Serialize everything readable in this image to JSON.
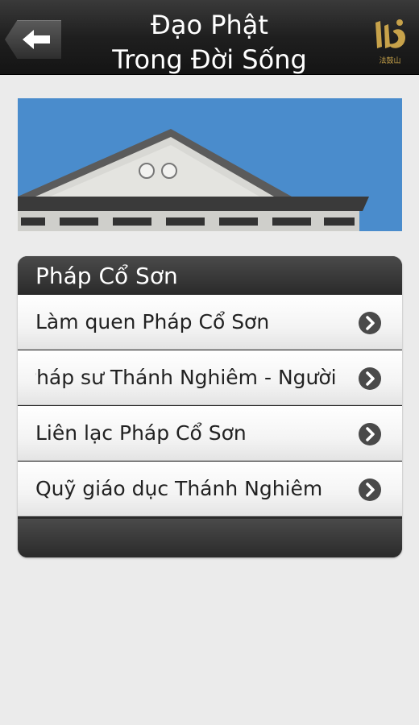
{
  "header": {
    "title_line1": "Đạo Phật",
    "title_line2": "Trong Đời Sống",
    "logo_caption": "法鼓山"
  },
  "section": {
    "title": "Pháp Cổ Sơn",
    "items": [
      {
        "label": "Làm quen Pháp Cổ Sơn"
      },
      {
        "label": "Pháp sư Thánh Nghiêm - Người"
      },
      {
        "label": "Liên lạc Pháp Cổ Sơn"
      },
      {
        "label": "Quỹ giáo dục Thánh Nghiêm"
      }
    ]
  },
  "colors": {
    "header_bg": "#1f1f1f",
    "page_bg": "#ebebeb",
    "logo_gold": "#c7a24a",
    "sky": "#4a8ccc"
  }
}
